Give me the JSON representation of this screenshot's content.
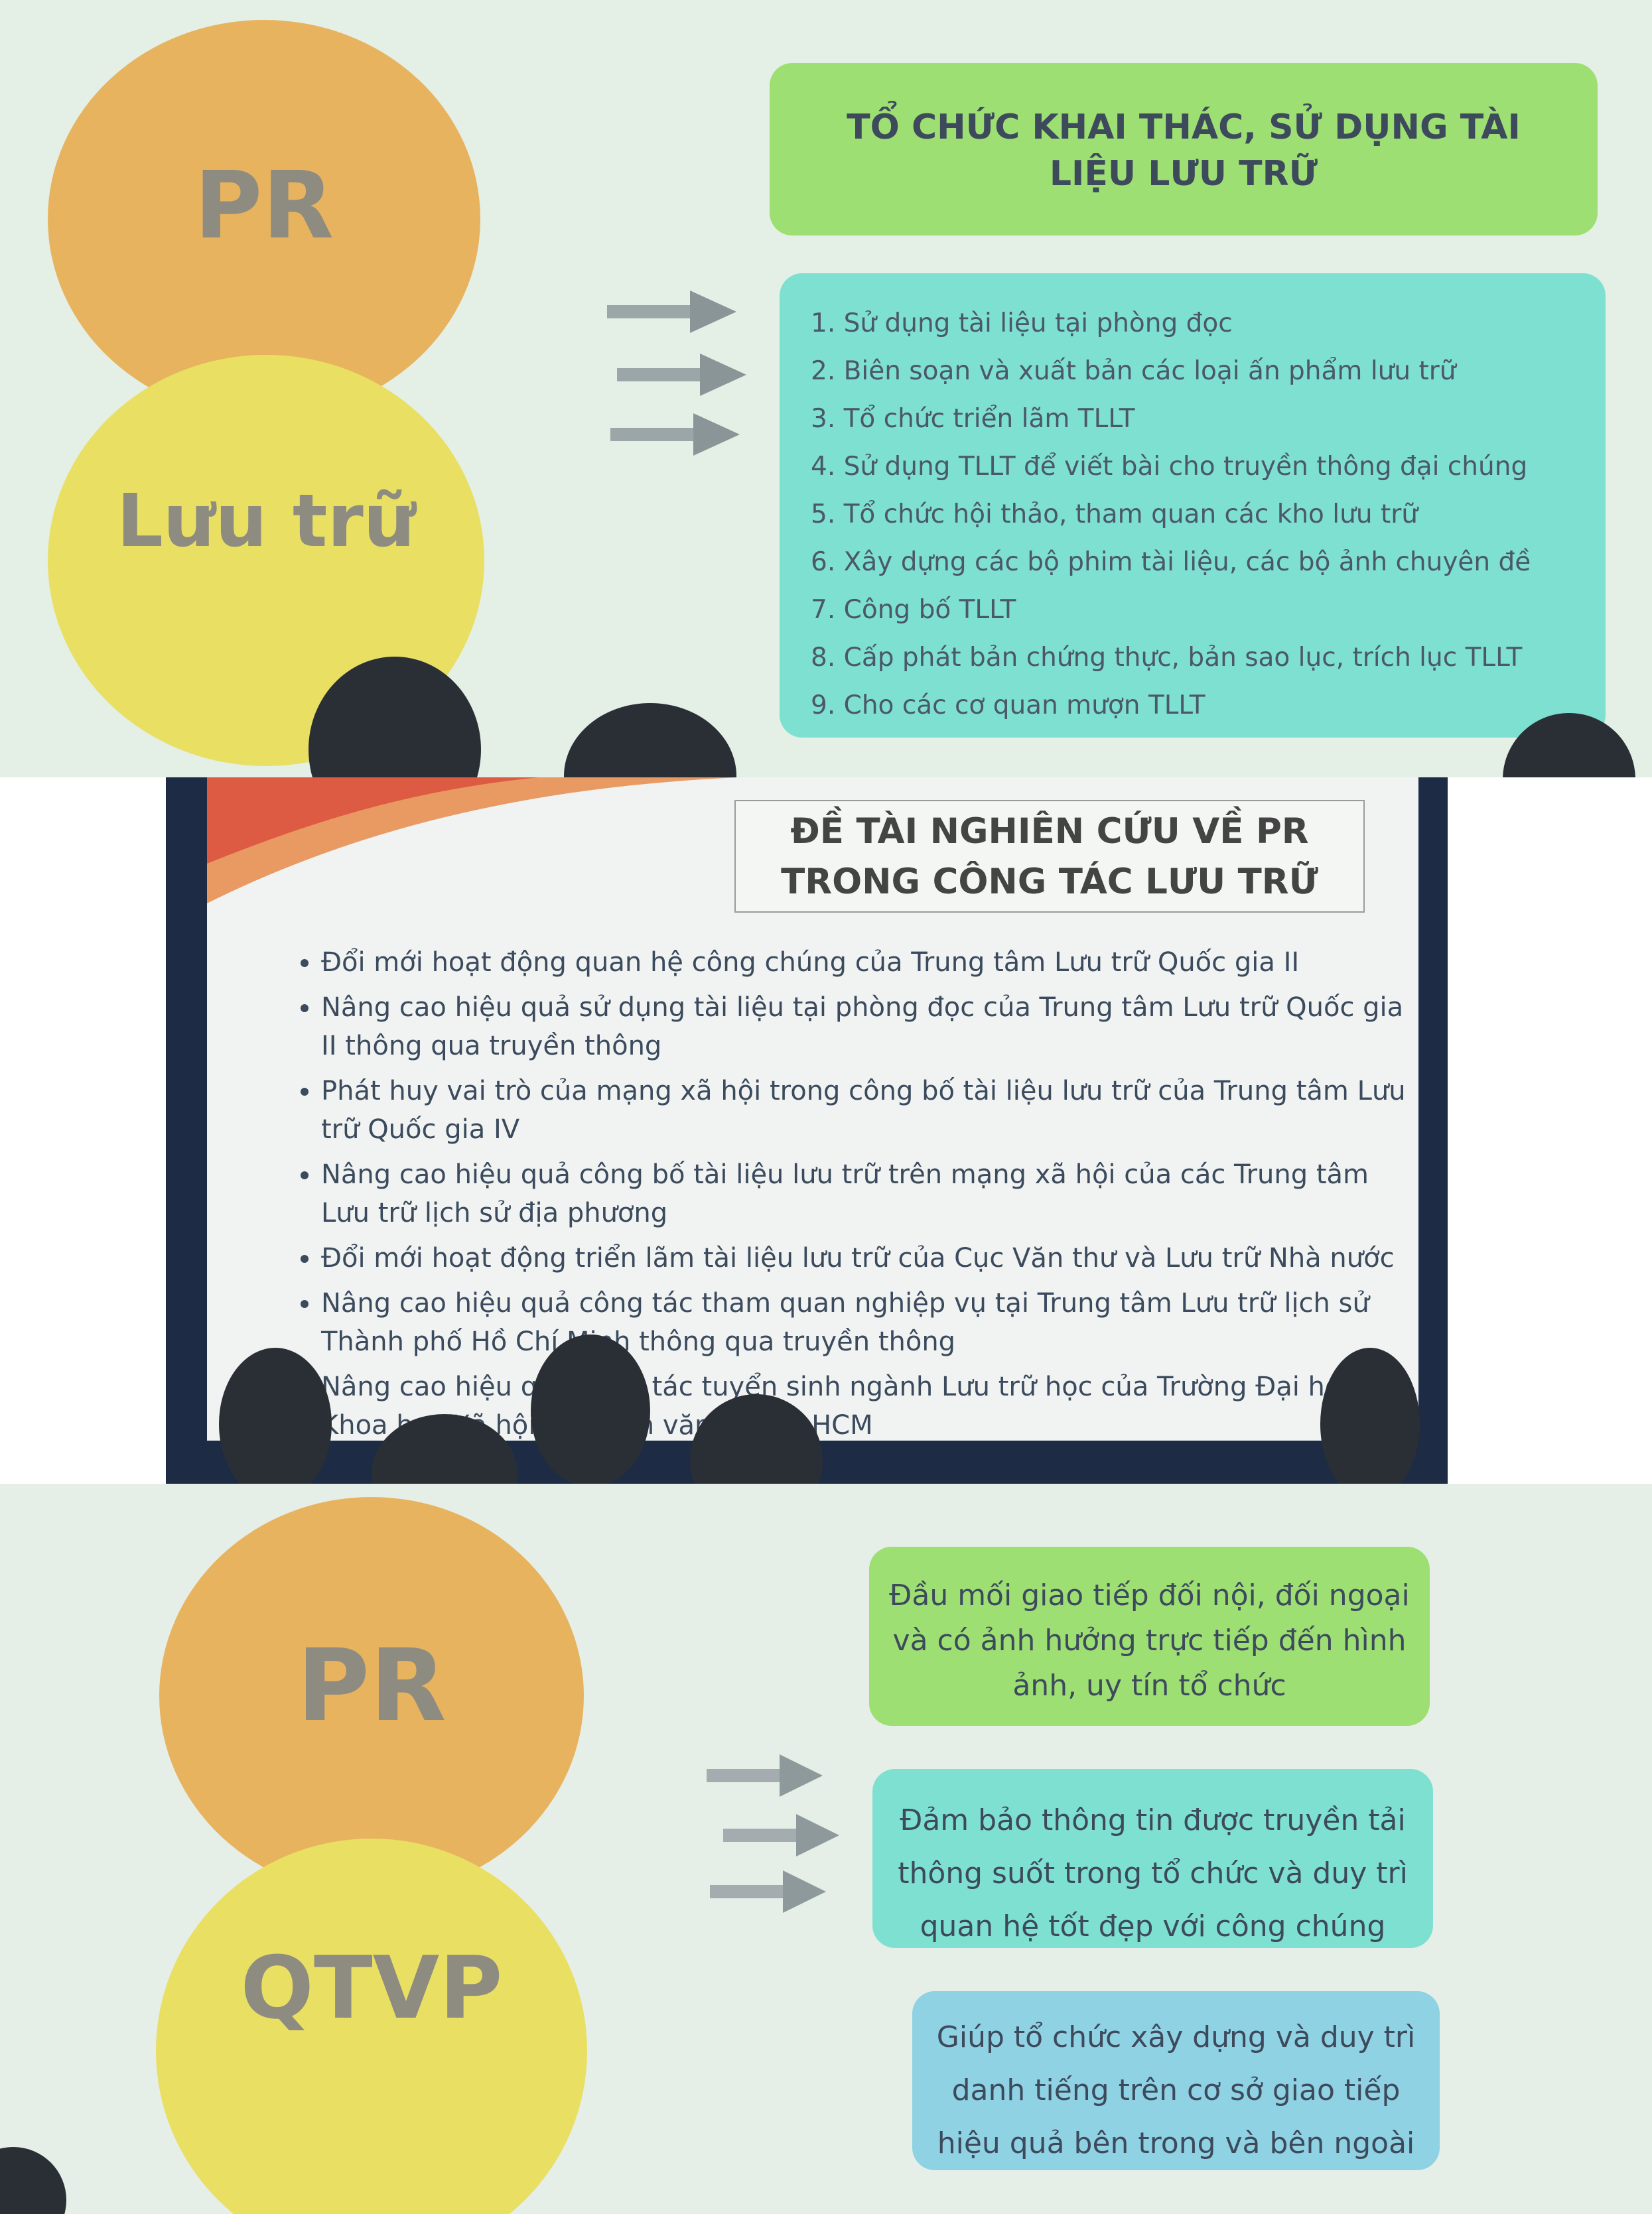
{
  "panel1": {
    "circle_top": "PR",
    "circle_bottom": "Lưu trữ",
    "title": "TỔ CHỨC KHAI THÁC, SỬ DỤNG TÀI LIỆU LƯU TRỮ",
    "items": [
      "1. Sử dụng tài liệu tại phòng đọc",
      "2. Biên soạn và xuất bản các loại ấn phẩm lưu trữ",
      "3. Tổ chức triển lãm TLLT",
      "4. Sử dụng TLLT để viết bài cho truyền thông đại chúng",
      "5. Tổ chức hội thảo, tham quan các kho lưu trữ",
      "6. Xây dựng các bộ phim tài liệu, các bộ ảnh chuyên đề",
      "7. Công bố TLLT",
      "8. Cấp phát bản chứng thực, bản sao lục, trích lục TLLT",
      "9. Cho các cơ quan mượn TLLT"
    ]
  },
  "panel2": {
    "title": "ĐỀ TÀI NGHIÊN CỨU VỀ PR TRONG CÔNG TÁC LƯU TRỮ",
    "items": [
      "Đổi mới hoạt động quan hệ công chúng của Trung tâm Lưu trữ Quốc gia II",
      "Nâng cao hiệu quả sử dụng tài liệu tại phòng đọc của Trung tâm Lưu trữ Quốc gia II thông qua truyền thông",
      "Phát huy vai trò của mạng xã hội trong công bố tài liệu lưu trữ của Trung tâm Lưu trữ Quốc gia IV",
      "Nâng cao hiệu quả công bố tài liệu lưu trữ trên mạng xã hội của các Trung tâm Lưu trữ lịch sử địa phương",
      "Đổi mới hoạt động triển lãm tài liệu lưu trữ của Cục Văn thư và Lưu trữ Nhà nước",
      "Nâng cao hiệu quả công tác tham quan nghiệp vụ tại Trung tâm Lưu trữ lịch sử Thành phố Hồ Chí Minh thông qua truyền thông",
      "Nâng cao hiệu quả công tác tuyển sinh ngành Lưu trữ học của Trường Đại học Khoa học Xã hội và Nhân văn ĐHQG-HCM"
    ]
  },
  "panel3": {
    "circle_top": "PR",
    "circle_bottom": "QTVP",
    "box1": "Đầu mối giao tiếp đối nội, đối ngoại và có ảnh hưởng trực tiếp đến hình ảnh, uy tín tổ chức",
    "box2": "Đảm bảo thông tin được truyền tải thông suốt trong tổ chức và duy trì quan hệ tốt đẹp với công chúng",
    "box3": "Giúp tổ chức xây dựng và duy trì danh tiếng trên cơ sở giao tiếp hiệu quả bên trong và bên ngoài"
  },
  "colors": {
    "orange_circle": "#e8b35e",
    "yellow_circle": "#e9df63",
    "green_box": "#9edf73",
    "teal_box": "#7ee0d0",
    "blue_box": "#8fd2e4"
  }
}
